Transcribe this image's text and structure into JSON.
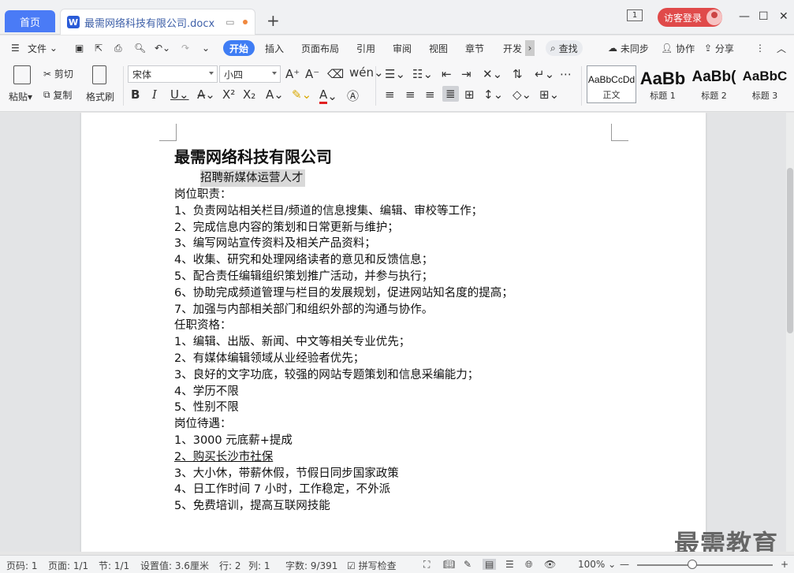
{
  "tabs": {
    "home": "首页",
    "doc": "最需网络科技有限公司.docx",
    "badge": "1",
    "login": "访客登录"
  },
  "menu": {
    "file": "文件",
    "items": [
      "开始",
      "插入",
      "页面布局",
      "引用",
      "审阅",
      "视图",
      "章节",
      "开发"
    ],
    "search": "查找",
    "sync": "未同步",
    "collab": "协作",
    "share": "分享"
  },
  "ribbon": {
    "paste": "粘贴",
    "cut": "剪切",
    "copy": "复制",
    "format_painter": "格式刷",
    "font_name": "宋体",
    "font_size": "小四",
    "styles": [
      {
        "sample": "AaBbCcDd",
        "name": "正文"
      },
      {
        "sample": "AaBb",
        "name": "标题 1"
      },
      {
        "sample": "AaBb(",
        "name": "标题 2"
      },
      {
        "sample": "AaBbC",
        "name": "标题 3"
      }
    ]
  },
  "document": {
    "title": "最需网络科技有限公司",
    "subtitle": "招聘新媒体运营人才",
    "lines": [
      "岗位职责：",
      "1、负责网站相关栏目/频道的信息搜集、编辑、审校等工作；",
      "2、完成信息内容的策划和日常更新与维护；",
      "3、编写网站宣传资料及相关产品资料；",
      "4、收集、研究和处理网络读者的意见和反馈信息；",
      "5、配合责任编辑组织策划推广活动，并参与执行；",
      "6、协助完成频道管理与栏目的发展规划，促进网站知名度的提高；",
      "7、加强与内部相关部门和组织外部的沟通与协作。",
      "任职资格：",
      "1、编辑、出版、新闻、中文等相关专业优先；",
      "2、有媒体编辑领域从业经验者优先；",
      "3、良好的文字功底，较强的网站专题策划和信息采编能力；",
      "4、学历不限",
      "5、性别不限",
      "岗位待遇：",
      "1、3000 元底薪+提成",
      "2、购买长沙市社保",
      "3、大小休，带薪休假，节假日同步国家政策",
      "4、日工作时间 7 小时，工作稳定，不外派",
      "5、免费培训，提高互联网技能"
    ]
  },
  "watermark": "最需教育",
  "status": {
    "page_code": "页码: 1",
    "page": "页面: 1/1",
    "section": "节: 1/1",
    "setting": "设置值: 3.6厘米",
    "row": "行: 2",
    "col": "列: 1",
    "words": "字数: 9/391",
    "spell": "拼写检查",
    "zoom": "100%",
    "zoom_value": 100
  },
  "colors": {
    "accent": "#3f7df4",
    "login": "#e04a4a",
    "home_tab": "#4a7bf6"
  }
}
